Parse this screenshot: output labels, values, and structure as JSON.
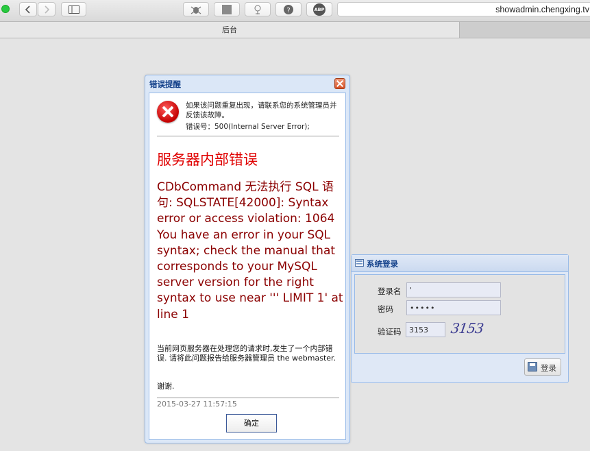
{
  "browser": {
    "url": "showadmin.chengxing.tv",
    "tab_title": "后台",
    "adblock_label": "ABP"
  },
  "error_dialog": {
    "title": "错误提醒",
    "hint": "如果该问题重复出现，请联系您的系统管理员并反馈该故障。",
    "error_code": "错误号：500(Internal Server Error);",
    "headline": "服务器内部错误",
    "message": "CDbCommand 无法执行 SQL 语句: SQLSTATE[42000]: Syntax error or access violation: 1064 You have an error in your SQL syntax; check the manual that corresponds to your MySQL server version for the right syntax to use near ''' LIMIT 1' at line 1",
    "description": "当前网页服务器在处理您的请求时,发生了一个内部错误. 请将此问题报告给服务器管理员 the webmaster.",
    "thanks": "谢谢.",
    "timestamp": "2015-03-27 11:57:15",
    "ok_label": "确定"
  },
  "login_panel": {
    "title": "系统登录",
    "username_label": "登录名",
    "username_value": "'",
    "password_label": "密码",
    "password_value": "•••••",
    "captcha_label": "验证码",
    "captcha_value": "3153",
    "captcha_image_text": "3153",
    "login_label": "登录"
  }
}
